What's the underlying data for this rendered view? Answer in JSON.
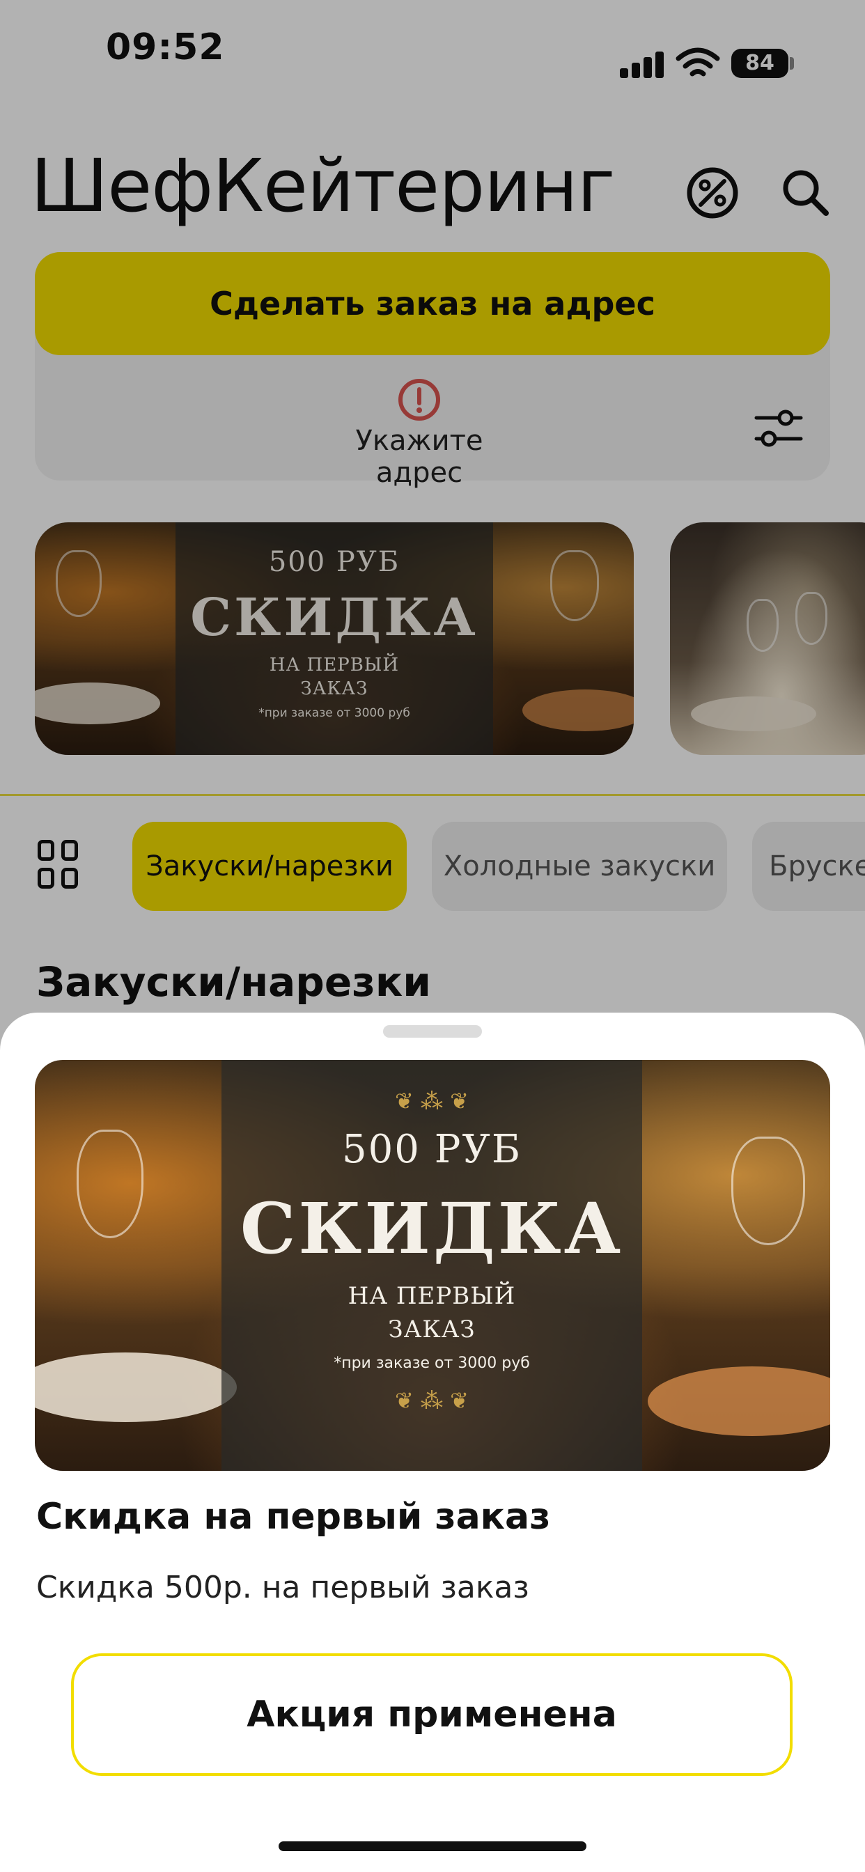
{
  "status_bar": {
    "time": "09:52",
    "battery": "84"
  },
  "header": {
    "title": "ШефКейтеринг"
  },
  "address": {
    "order_button": "Сделать заказ на адрес",
    "prompt": "Укажите адрес"
  },
  "promo_banner": {
    "amount": "500 РУБ",
    "headline": "СКИДКА",
    "line1": "НА ПЕРВЫЙ",
    "line2": "ЗАКАЗ",
    "note": "*при заказе от 3000 руб"
  },
  "categories": {
    "items": [
      "Закуски/нарезки",
      "Холодные закуски",
      "Брускетты"
    ],
    "active": "Закуски/нарезки"
  },
  "section": {
    "title": "Закуски/нарезки"
  },
  "sheet": {
    "title": "Скидка на первый заказ",
    "description": "Скидка 500р. на первый заказ",
    "button": "Акция применена"
  },
  "colors": {
    "accent": "#f2dd00",
    "text": "#111111",
    "muted_bg": "#f2f2f2"
  }
}
